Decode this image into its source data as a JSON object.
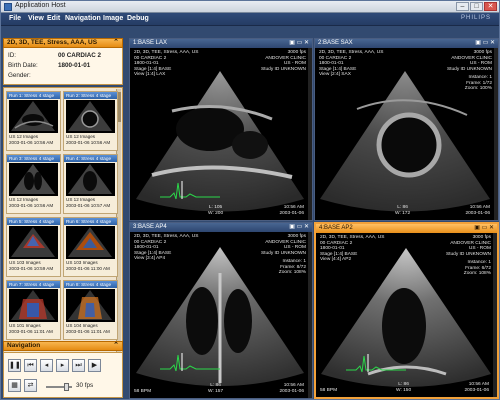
{
  "window": {
    "title": "Application Host",
    "brand": "PHILIPS",
    "controls": {
      "minimize": "–",
      "maximize": "□",
      "close": "✕"
    }
  },
  "menu": [
    "File",
    "View",
    "Edit",
    "Navigation",
    "Image",
    "Debug"
  ],
  "patient": {
    "header": "2D, 3D, TEE, Stress, AAA, US",
    "id_label": "ID:",
    "id": "00 CARDIAC 2",
    "birth_label": "Birth Date:",
    "birth": "1800-01-01",
    "gender_label": "Gender:",
    "gender": ""
  },
  "thumbnails": [
    {
      "title": "Run 1: Stress 4 stage",
      "count": "US 12 Images",
      "date": "2003-01-06 10:56 AM"
    },
    {
      "title": "Run 2: Stress 4 stage",
      "count": "US 12 Images",
      "date": "2003-01-06 10:56 AM"
    },
    {
      "title": "Run 3: Stress 4 stage",
      "count": "US 12 Images",
      "date": "2003-01-06 10:56 AM"
    },
    {
      "title": "Run 4: Stress 4 stage",
      "count": "US 12 Images",
      "date": "2003-01-06 10:57 AM"
    },
    {
      "title": "Run 5: Stress 4 stage",
      "count": "US 103 Images",
      "date": "2003-01-06 10:59 AM"
    },
    {
      "title": "Run 6: Stress 4 stage",
      "count": "US 103 Images",
      "date": "2003-01-06 11:00 AM"
    },
    {
      "title": "Run 7: Stress 4 stage",
      "count": "US 101 Images",
      "date": "2003-01-06 11:01 AM"
    },
    {
      "title": "Run 8: Stress 4 stage",
      "count": "US 104 Images",
      "date": "2003-01-06 11:01 AM"
    }
  ],
  "navigation": {
    "title": "Navigation",
    "fps": "30 fps"
  },
  "viewports": [
    {
      "label": "1:BASE LAX",
      "tl": "2D, 3D, TEE, Stress, AAA, US\n00 CARDIAC 2\n1800-01-01\nStage [1:4] BASE\nView [1:4] LAX",
      "tr": "3000 fps\nANDOVER CLINIC\nUS - ROM\nStudy ID UNKNOWN",
      "r2": "",
      "bl": "",
      "bc": "L: 105\nW: 200",
      "br": "10:56 AM\n2003-01-06"
    },
    {
      "label": "2:BASE SAX",
      "tl": "2D, 3D, TEE, Stress, AAA, US\n00 CARDIAC 2\n1800-01-01\nStage [1:4] BASE\nView [2:4] SAX",
      "tr": "3000 fps\nANDOVER CLINIC\nUS - ROM\nStudy ID UNKNOWN",
      "r2": "Instance: 1\nFrame: 1/72\nZoom: 100%",
      "bl": "",
      "bc": "L: 86\nW: 172",
      "br": "10:56 AM\n2003-01-06"
    },
    {
      "label": "3:BASE AP4",
      "tl": "2D, 3D, TEE, Stress, AAA, US\n00 CARDIAC 2\n1800-01-01\nStage [1:4] BASE\nView [3:4] AP4",
      "tr": "3000 fps\nANDOVER CLINIC\nUS - ROM\nStudy ID UNKNOWN",
      "r2": "Instance: 1\nFrame: 8/72\nZoom: 108%",
      "bl": "58 BPM",
      "bc": "L: 86\nW: 157",
      "br": "10:56 AM\n2003-01-06"
    },
    {
      "label": "4:BASE AP2",
      "tl": "2D, 3D, TEE, Stress, AAA, US\n00 CARDIAC 2\n1800-01-01\nStage [1:4] BASE\nView [4:4] AP2",
      "tr": "3000 fps\nANDOVER CLINIC\nUS - ROM\nStudy ID UNKNOWN",
      "r2": "Instance: 1\nFrame: 6/72\nZoom: 108%",
      "bl": "58 BPM",
      "bc": "L: 86\nW: 150",
      "br": "10:56 AM\n2003-01-06"
    }
  ],
  "colors": {
    "accent": "#f2a13a",
    "frame": "#324a70",
    "ecg": "#2bd84a"
  }
}
